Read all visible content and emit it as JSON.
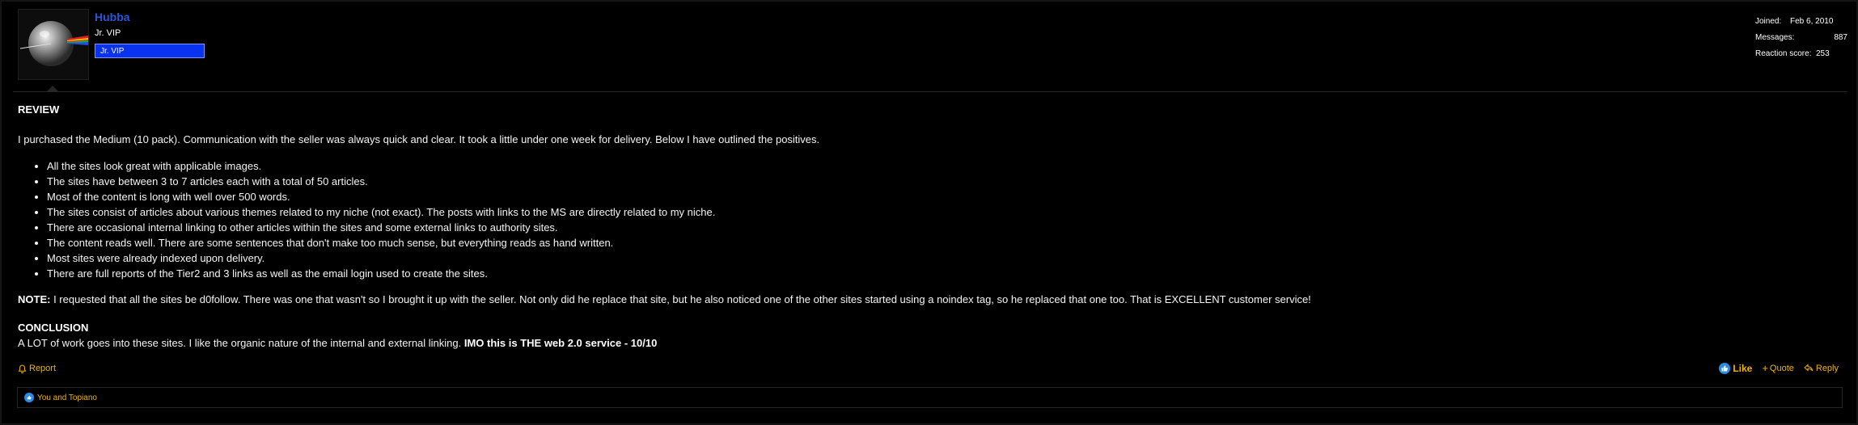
{
  "user": {
    "name": "Hubba",
    "title": "Jr. VIP",
    "banner": "Jr. VIP"
  },
  "stats": {
    "joined_label": "Joined:",
    "joined_value": "Feb 6, 2010",
    "messages_label": "Messages:",
    "messages_value": "887",
    "reaction_label": "Reaction score:",
    "reaction_value": "253"
  },
  "post": {
    "review_heading": "REVIEW",
    "intro": "I purchased the Medium (10 pack). Communication with the seller was always quick and clear. It took a little under one week for delivery. Below I have outlined the positives.",
    "positives": [
      "All the sites look great with applicable images.",
      "The sites have between 3 to 7 articles each with a total of 50 articles.",
      "Most of the content is long with well over 500 words.",
      "The sites consist of articles about various themes related to my niche (not exact). The posts with links to the MS are directly related to my niche.",
      "There are occasional internal linking to other articles within the sites and some external links to authority sites.",
      "The content reads well. There are some sentences that don't make too much sense, but everything reads as hand written.",
      "Most sites were already indexed upon delivery.",
      "There are full reports of the Tier2 and 3 links as well as the email login used to create the sites."
    ],
    "note_label": "NOTE:",
    "note_text": " I requested that all the sites be d0follow. There was one that wasn't so I brought it up with the seller. Not only did he replace that site, but he also noticed one of the other sites started using a noindex tag, so he replaced that one too. That is EXCELLENT customer service!",
    "conclusion_heading": "CONCLUSION",
    "conclusion_text": "A LOT of work goes into these sites. I like the organic nature of the internal and external linking. ",
    "conclusion_verdict": "IMO this is THE web 2.0 service - 10/10"
  },
  "actions": {
    "report": "Report",
    "like": "Like",
    "quote": "Quote",
    "reply": "Reply"
  },
  "reactions": {
    "text": "You and Topiano"
  },
  "colors": {
    "accent": "#f0b400",
    "username": "#2a55d8",
    "banner": "#0a33f0",
    "background": "#000000"
  }
}
